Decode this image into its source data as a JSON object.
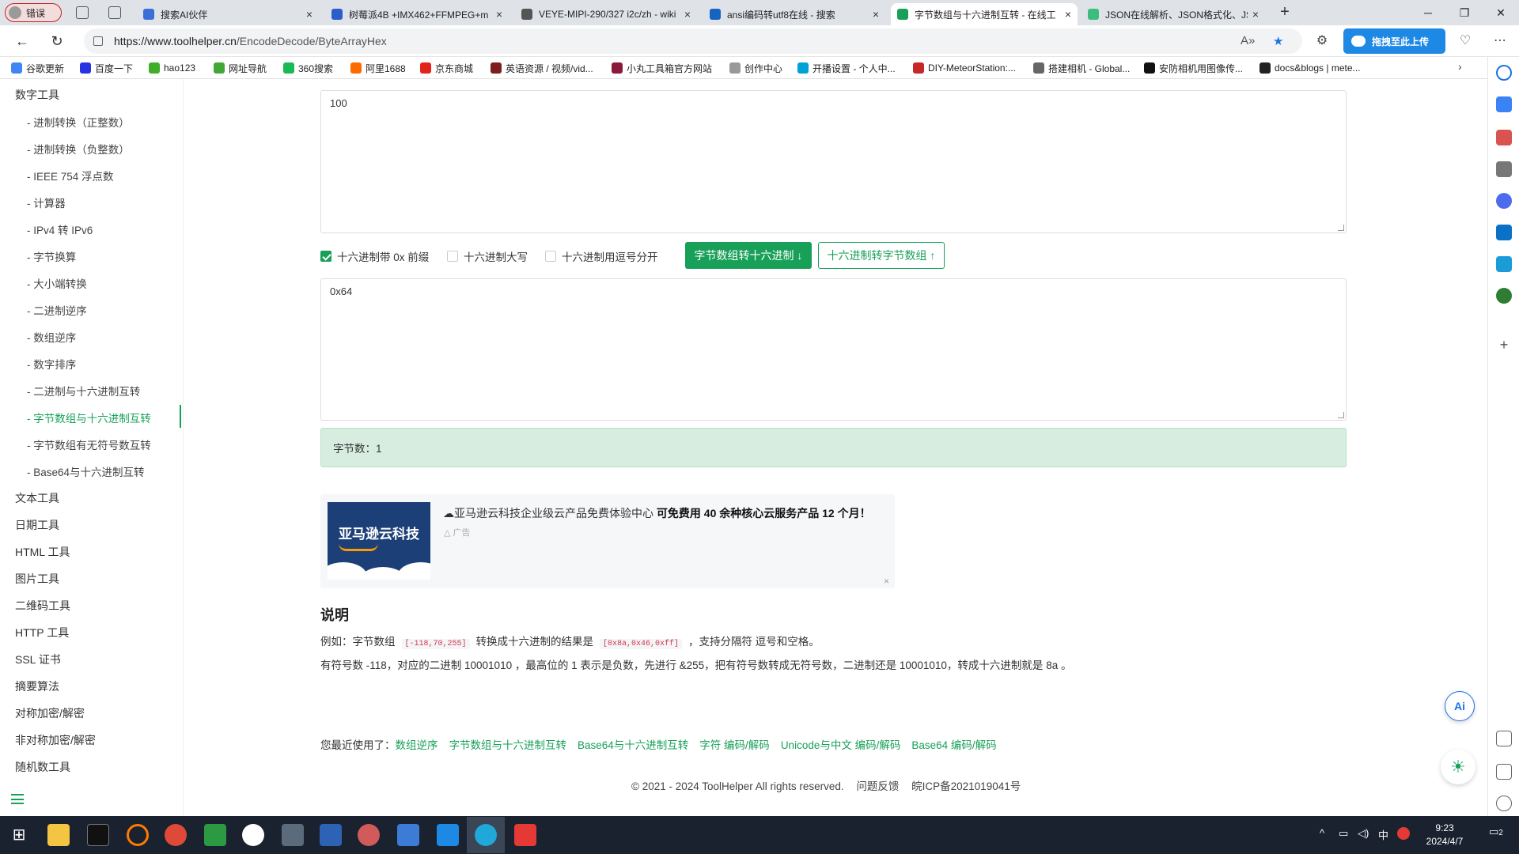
{
  "browser": {
    "profile_label": "错误",
    "tabs": [
      {
        "title": "搜索AI伙伴",
        "color": "#3b6fd8"
      },
      {
        "title": "树莓派4B +IMX462+FFMPEG+m",
        "color": "#2a5ec9"
      },
      {
        "title": "VEYE-MIPI-290/327 i2c/zh - wiki",
        "color": "#555555"
      },
      {
        "title": "ansi编码转utf8在线 - 搜索",
        "color": "#1565c0"
      },
      {
        "title": "字节数组与十六进制互转 - 在线工",
        "color": "#18a058"
      },
      {
        "title": "JSON在线解析、JSON格式化、JS",
        "color": "#3dbd7d"
      }
    ],
    "url_host": "https://www.toolhelper.cn",
    "url_path": "/EncodeDecode/ByteArrayHex",
    "upload_label": "拖拽至此上传",
    "bookmarks": [
      {
        "label": "谷歌更新",
        "color": "#4285f4"
      },
      {
        "label": "百度一下",
        "color": "#2932e1"
      },
      {
        "label": "hao123",
        "color": "#3fae29"
      },
      {
        "label": "网址导航",
        "color": "#41a836"
      },
      {
        "label": "360搜索",
        "color": "#19b955"
      },
      {
        "label": "阿里1688",
        "color": "#ff6a00"
      },
      {
        "label": "京东商城",
        "color": "#e1251b"
      },
      {
        "label": "英语资源 / 视频/vid...",
        "color": "#7a1e1e"
      },
      {
        "label": "小丸工具箱官方网站",
        "color": "#8b1a3a"
      },
      {
        "label": "创作中心",
        "color": "#999999"
      },
      {
        "label": "开播设置 - 个人中...",
        "color": "#00a1d6"
      },
      {
        "label": "DIY-MeteorStation:...",
        "color": "#c62828"
      },
      {
        "label": "搭建相机 - Global...",
        "color": "#666666"
      },
      {
        "label": "安防相机用图像传...",
        "color": "#111111"
      },
      {
        "label": "docs&blogs | mete...",
        "color": "#222222"
      }
    ]
  },
  "sidebar": {
    "category_top": "数字工具",
    "items": [
      "- 进制转换（正整数）",
      "- 进制转换（负整数）",
      "- IEEE 754 浮点数",
      "- 计算器",
      "- IPv4 转 IPv6",
      "- 字节换算",
      "- 大小端转换",
      "- 二进制逆序",
      "- 数组逆序",
      "- 数字排序",
      "- 二进制与十六进制互转",
      "- 字节数组与十六进制互转",
      "- 字节数组有无符号数互转",
      "- Base64与十六进制互转"
    ],
    "active_index": 11,
    "categories": [
      "文本工具",
      "日期工具",
      "HTML 工具",
      "图片工具",
      "二维码工具",
      "HTTP 工具",
      "SSL 证书",
      "摘要算法",
      "对称加密/解密",
      "非对称加密/解密",
      "随机数工具"
    ]
  },
  "main": {
    "input_value": "100",
    "options": [
      {
        "label": "十六进制带 0x 前缀",
        "checked": true
      },
      {
        "label": "十六进制大写",
        "checked": false
      },
      {
        "label": "十六进制用逗号分开",
        "checked": false
      }
    ],
    "btn_to_hex": "字节数组转十六进制 ↓",
    "btn_to_bytes": "十六进制转字节数组 ↑",
    "output_value": "0x64",
    "byte_count": "字节数：1",
    "ad": {
      "img_text": "亚马逊云科技",
      "title_plain": "亚马逊云科技企业级云产品免费体验中心",
      "title_bold": "可免费用 40 余种核心云服务产品 12 个月！",
      "label": "广告",
      "close": "×"
    },
    "explain_title": "说明",
    "explain_1_a": "例如：字节数组",
    "explain_1_code1": "[-118,70,255]",
    "explain_1_b": "转换成十六进制的结果是",
    "explain_1_code2": "[0x8a,0x46,0xff]",
    "explain_1_c": "，支持分隔符 逗号和空格。",
    "explain_2": "有符号数 -118，对应的二进制 10001010 ，最高位的 1 表示是负数，先进行 &255，把有符号数转成无符号数，二进制还是 10001010，转成十六进制就是 8a 。",
    "recent_label": "您最近使用了：",
    "recent_links": [
      "数组逆序",
      "字节数组与十六进制互转",
      "Base64与十六进制互转",
      "字符 编码/解码",
      "Unicode与中文 编码/解码",
      "Base64 编码/解码"
    ],
    "footer_copy": "© 2021 - 2024 ToolHelper All rights reserved.",
    "footer_feedback": "问题反馈",
    "footer_icp": "皖ICP备2021019041号",
    "ai_label": "Ai"
  },
  "taskbar": {
    "time": "9:23",
    "date": "2024/4/7",
    "ime": "中",
    "notif_count": "2"
  }
}
